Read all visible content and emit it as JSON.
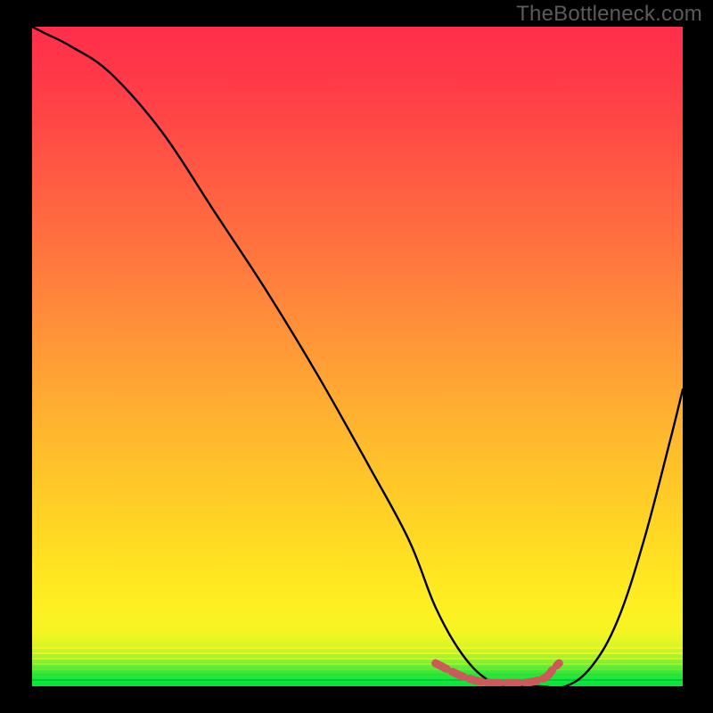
{
  "watermark": "TheBottleneck.com",
  "colors": {
    "page_bg": "#000000",
    "curve": "#000000",
    "marker": "#cc5a5a",
    "watermark": "#5b5b5b"
  },
  "chart_data": {
    "type": "line",
    "title": "",
    "xlabel": "",
    "ylabel": "",
    "xlim": [
      0,
      100
    ],
    "ylim": [
      0,
      100
    ],
    "grid": false,
    "series": [
      {
        "name": "curve",
        "x": [
          0,
          2,
          6,
          12,
          20,
          28,
          36,
          44,
          52,
          58,
          62,
          66,
          70,
          74,
          78,
          82,
          86,
          90,
          94,
          98,
          100
        ],
        "values": [
          100,
          99,
          97,
          93,
          84,
          72,
          60,
          47,
          33,
          22,
          12,
          5,
          1,
          0,
          0,
          0,
          3,
          10,
          22,
          37,
          45
        ]
      },
      {
        "name": "marker",
        "x": [
          62,
          65,
          67,
          69,
          71,
          73,
          75,
          77,
          79,
          80,
          81
        ],
        "values": [
          3.5,
          2.0,
          1.2,
          0.7,
          0.5,
          0.5,
          0.5,
          0.7,
          1.4,
          2.5,
          3.5
        ]
      }
    ],
    "gradient_stops": [
      {
        "pos": 0,
        "color": "#00e63e"
      },
      {
        "pos": 8,
        "color": "#f3f523"
      },
      {
        "pos": 50,
        "color": "#ff9239"
      },
      {
        "pos": 100,
        "color": "#ff2e4b"
      }
    ]
  }
}
